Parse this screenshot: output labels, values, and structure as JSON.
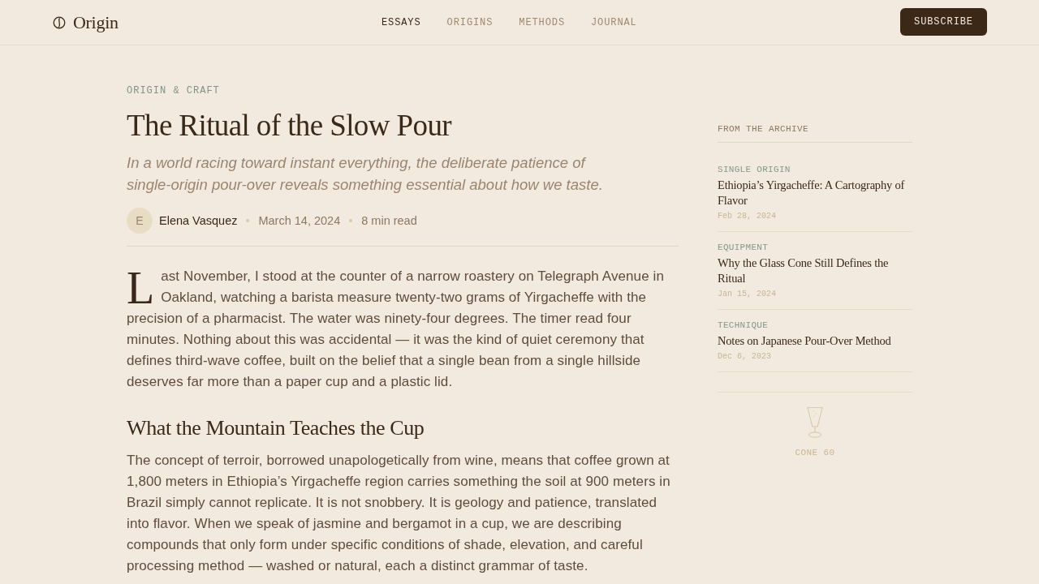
{
  "header": {
    "logo": "Origin",
    "nav": [
      {
        "label": "ESSAYS",
        "selected": true
      },
      {
        "label": "ORIGINS",
        "selected": false
      },
      {
        "label": "METHODS",
        "selected": false
      },
      {
        "label": "JOURNAL",
        "selected": false
      }
    ],
    "subscribe_button": "SUBSCRIBE"
  },
  "article": {
    "category": "ORIGIN & CRAFT",
    "title": "The Ritual of the Slow Pour",
    "subtitle": "In a world racing toward instant everything, the deliberate patience of single-origin pour-over reveals something essential about how we taste.",
    "author": {
      "initial": "E",
      "name": "Elena Vasquez"
    },
    "date": "March 14, 2024",
    "read_time": "8 min read",
    "body": [
      {
        "kind": "paragraph",
        "drop_cap": true,
        "text": "Last November, I stood at the counter of a narrow roastery on Telegraph Avenue in Oakland, watching a barista measure twenty-two grams of Yirgacheffe with the precision of a pharmacist. The water was ninety-four degrees. The timer read four minutes. Nothing about this was accidental — it was the kind of quiet ceremony that defines third-wave coffee, built on the belief that a single bean from a single hillside deserves far more than a paper cup and a plastic lid."
      },
      {
        "kind": "heading",
        "text": "What the Mountain Teaches the Cup"
      },
      {
        "kind": "paragraph",
        "drop_cap": false,
        "text": "The concept of terroir, borrowed unapologetically from wine, means that coffee grown at 1,800 meters in Ethiopia’s Yirgacheffe region carries something the soil at 900 meters in Brazil simply cannot replicate. It is not snobbery. It is geology and patience, translated into flavor. When we speak of jasmine and bergamot in a cup, we are describing compounds that only form under specific conditions of shade, elevation, and careful processing method — washed or natural, each a distinct grammar of taste."
      }
    ]
  },
  "sidebar": {
    "heading": "FROM THE ARCHIVE",
    "items": [
      {
        "category": "SINGLE ORIGIN",
        "title": "Ethiopia’s Yirgacheffe: A Cartography of Flavor",
        "date": "Feb 28, 2024"
      },
      {
        "category": "EQUIPMENT",
        "title": "Why the Glass Cone Still Defines the Ritual",
        "date": "Jan 15, 2024"
      },
      {
        "category": "TECHNIQUE",
        "title": "Notes on Japanese Pour-Over Method",
        "date": "Dec 6, 2023"
      }
    ],
    "feature": {
      "label": "CONE 60"
    }
  }
}
